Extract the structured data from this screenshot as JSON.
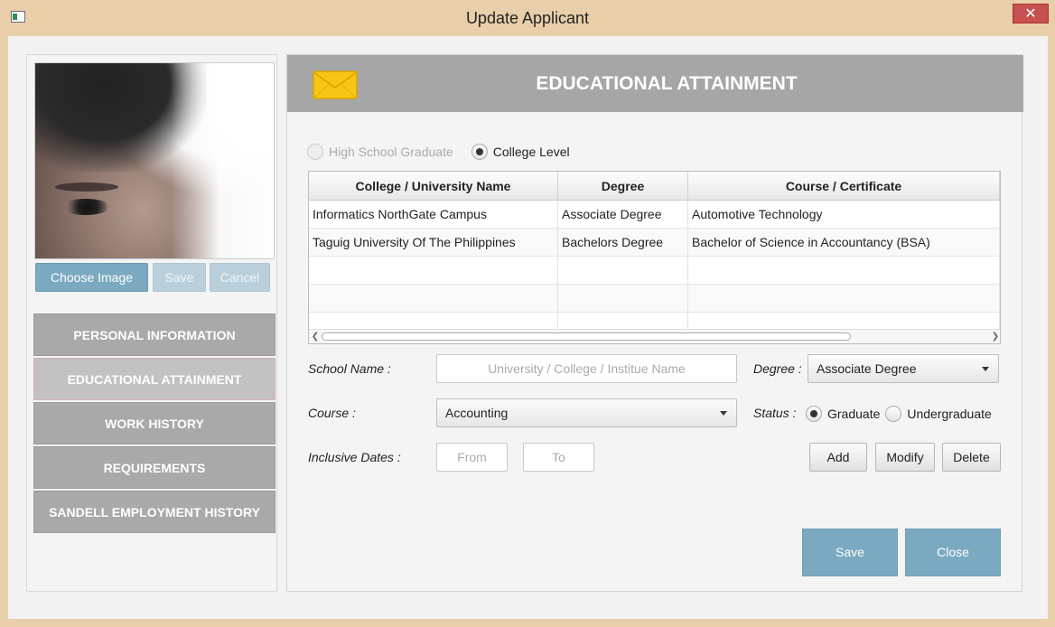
{
  "window": {
    "title": "Update Applicant",
    "close_glyph": "✕"
  },
  "photo_buttons": {
    "choose": "Choose Image",
    "save": "Save",
    "cancel": "Cancel"
  },
  "nav": {
    "items": [
      {
        "label": "PERSONAL INFORMATION",
        "active": false
      },
      {
        "label": "EDUCATIONAL ATTAINMENT",
        "active": true
      },
      {
        "label": "WORK HISTORY",
        "active": false
      },
      {
        "label": "REQUIREMENTS",
        "active": false
      },
      {
        "label": "SANDELL EMPLOYMENT HISTORY",
        "active": false
      }
    ]
  },
  "header": {
    "title": "EDUCATIONAL ATTAINMENT",
    "icon": "envelope-icon"
  },
  "level": {
    "high_school": "High School Graduate",
    "college": "College Level",
    "selected": "college"
  },
  "table": {
    "columns": [
      "College / University Name",
      "Degree",
      "Course / Certificate"
    ],
    "rows": [
      [
        "Informatics NorthGate Campus",
        "Associate Degree",
        "Automotive Technology"
      ],
      [
        "Taguig University Of The Philippines",
        "Bachelors Degree",
        "Bachelor of Science in Accountancy (BSA)"
      ]
    ]
  },
  "form": {
    "school_label": "School Name :",
    "school_placeholder": "University / College / Institue Name",
    "degree_label": "Degree :",
    "degree_value": "Associate Degree",
    "course_label": "Course :",
    "course_value": "Accounting",
    "status_label": "Status :",
    "status_graduate": "Graduate",
    "status_undergraduate": "Undergraduate",
    "status_selected": "graduate",
    "dates_label": "Inclusive Dates :",
    "from_placeholder": "From",
    "to_placeholder": "To"
  },
  "row_actions": {
    "add": "Add",
    "modify": "Modify",
    "delete": "Delete"
  },
  "footer": {
    "save": "Save",
    "close": "Close"
  },
  "colors": {
    "accent_blue": "#7aa9c0",
    "nav_gray": "#a9a9a9",
    "header_gray": "#a6a6a6",
    "title_bar": "#e9cfa9"
  }
}
